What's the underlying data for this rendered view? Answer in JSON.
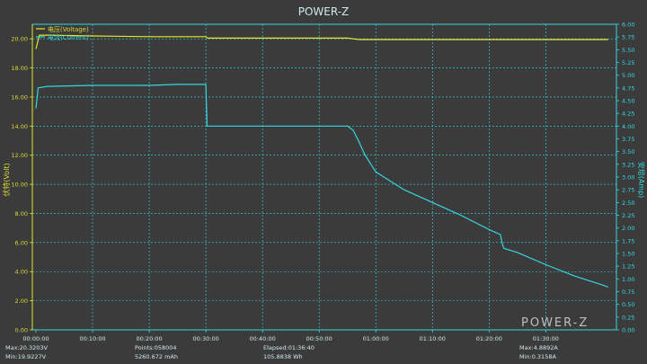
{
  "app": {
    "title": "POWER-Z",
    "watermark": "POWER-Z"
  },
  "colors": {
    "background": "#3b3b3b",
    "voltage": "#e6e62a",
    "current": "#35d7e0",
    "grid": "#35d7e0",
    "text_cyan": "#35d7e0",
    "text_yellow": "#d7d73a",
    "text_light": "#cfe9ea"
  },
  "chart_data": {
    "type": "line",
    "title": "POWER-Z",
    "xlabel": "",
    "ylabel_left": "伏特(Volt)",
    "ylabel_right": "安培(Amp)",
    "x_unit": "minutes",
    "xlim": [
      0,
      102
    ],
    "ylim_left": [
      0,
      21
    ],
    "ylim_right": [
      0,
      6
    ],
    "grid": true,
    "legend_position": "top-left",
    "x_ticks": [
      {
        "value": 0,
        "label": "00:00:00"
      },
      {
        "value": 10,
        "label": "00:10:00"
      },
      {
        "value": 20,
        "label": "00:20:00"
      },
      {
        "value": 30,
        "label": "00:30:00"
      },
      {
        "value": 40,
        "label": "00:40:00"
      },
      {
        "value": 50,
        "label": "00:50:00"
      },
      {
        "value": 60,
        "label": "01:00:00"
      },
      {
        "value": 70,
        "label": "01:10:00"
      },
      {
        "value": 80,
        "label": "01:20:00"
      },
      {
        "value": 90,
        "label": "01:30:00"
      }
    ],
    "y_left_ticks": [
      "0.00",
      "2.00",
      "4.00",
      "6.00",
      "8.00",
      "10.00",
      "12.00",
      "14.00",
      "16.00",
      "18.00",
      "20.00"
    ],
    "y_left_values": [
      0,
      2,
      4,
      6,
      8,
      10,
      12,
      14,
      16,
      18,
      20
    ],
    "y_right_ticks": [
      "0.00",
      "0.25",
      "0.50",
      "0.75",
      "1.00",
      "1.25",
      "1.50",
      "1.75",
      "2.00",
      "2.25",
      "2.50",
      "2.75",
      "3.00",
      "3.25",
      "3.50",
      "3.75",
      "4.00",
      "4.25",
      "4.50",
      "4.75",
      "5.00",
      "5.25",
      "5.50",
      "5.75",
      "6.00"
    ],
    "y_right_values": [
      0,
      0.25,
      0.5,
      0.75,
      1,
      1.25,
      1.5,
      1.75,
      2,
      2.25,
      2.5,
      2.75,
      3,
      3.25,
      3.5,
      3.75,
      4,
      4.25,
      4.5,
      4.75,
      5,
      5.25,
      5.5,
      5.75,
      6
    ],
    "series": [
      {
        "name": "电压(Voltage)",
        "axis": "left",
        "x": [
          0,
          0.6,
          2,
          10,
          20,
          30,
          30.3,
          34,
          40,
          50,
          55,
          57,
          60,
          70,
          80,
          90,
          96,
          101
        ],
        "y": [
          19.3,
          20.25,
          20.25,
          20.2,
          20.15,
          20.15,
          20.05,
          20.05,
          20.05,
          20.05,
          20.05,
          19.95,
          19.95,
          19.95,
          19.95,
          19.95,
          19.95,
          19.95
        ]
      },
      {
        "name": "电流(Current)",
        "axis": "right",
        "x": [
          0,
          0.4,
          2,
          10,
          20,
          25,
          30,
          30.2,
          35,
          40,
          50,
          55,
          56,
          57,
          58,
          60,
          65,
          70,
          75,
          80,
          82,
          82.3,
          82.6,
          85,
          90,
          95,
          100,
          101
        ],
        "y": [
          4.35,
          4.75,
          4.78,
          4.8,
          4.8,
          4.82,
          4.82,
          4.0,
          4.0,
          4.0,
          4.0,
          4.0,
          3.92,
          3.7,
          3.45,
          3.1,
          2.75,
          2.5,
          2.25,
          1.97,
          1.87,
          1.7,
          1.6,
          1.52,
          1.28,
          1.06,
          0.88,
          0.84
        ]
      }
    ],
    "stats": [
      {
        "label": "Max:20.3203V",
        "value": 20.3203,
        "unit": "V"
      },
      {
        "label": "Min:19.9227V",
        "value": 19.9227,
        "unit": "V"
      },
      {
        "label": "Points:058004",
        "value": 58004
      },
      {
        "label": "5260.672 mAh",
        "value": 5260.672,
        "unit": "mAh"
      },
      {
        "label": "Elapsed:01:36:40",
        "value": "01:36:40"
      },
      {
        "label": "105.8838 Wh",
        "value": 105.8838,
        "unit": "Wh"
      },
      {
        "label": "Max:4.8892A",
        "value": 4.8892,
        "unit": "A"
      },
      {
        "label": "Min:0.3158A",
        "value": 0.3158,
        "unit": "A"
      }
    ]
  }
}
